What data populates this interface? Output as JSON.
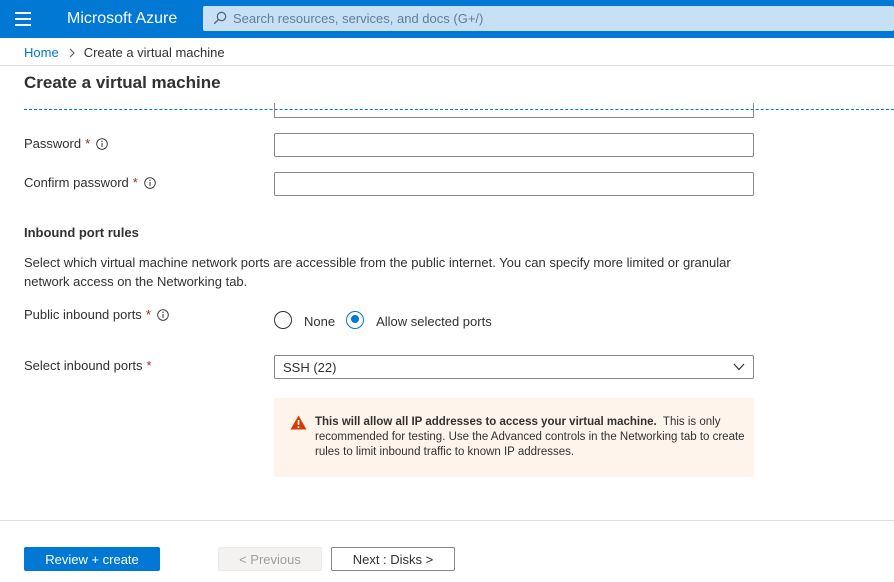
{
  "header": {
    "brand": "Microsoft Azure",
    "search_placeholder": "Search resources, services, and docs (G+/)"
  },
  "breadcrumb": {
    "home": "Home",
    "current": "Create a virtual machine"
  },
  "page": {
    "title": "Create a virtual machine"
  },
  "form": {
    "password_label": "Password",
    "password_value": "",
    "confirm_password_label": "Confirm password",
    "confirm_password_value": "",
    "required_mark": "*",
    "inbound": {
      "heading": "Inbound port rules",
      "description": "Select which virtual machine network ports are accessible from the public internet. You can specify more limited or granular network access on the Networking tab.",
      "public_ports_label": "Public inbound ports",
      "public_ports_options": [
        {
          "label": "None",
          "selected": false
        },
        {
          "label": "Allow selected ports",
          "selected": true
        }
      ],
      "select_ports_label": "Select inbound ports",
      "select_ports_value": "SSH (22)"
    },
    "warning": {
      "bold": "This will allow all IP addresses to access your virtual machine.",
      "text": "This is only recommended for testing.  Use the Advanced controls in the Networking tab to create rules to limit inbound traffic to known IP addresses."
    }
  },
  "footer": {
    "review_create": "Review + create",
    "previous": "< Previous",
    "next": "Next : Disks >"
  },
  "colors": {
    "accent": "#0078d4",
    "required": "#a4262c",
    "warning_bg": "#fff4ec",
    "warning_icon": "#d83b01"
  },
  "icons": {
    "menu": "hamburger-menu-icon",
    "search": "search-icon",
    "breadcrumb_sep": "chevron-right-icon",
    "info": "info-icon",
    "dropdown": "chevron-down-icon",
    "warning": "warning-icon"
  }
}
